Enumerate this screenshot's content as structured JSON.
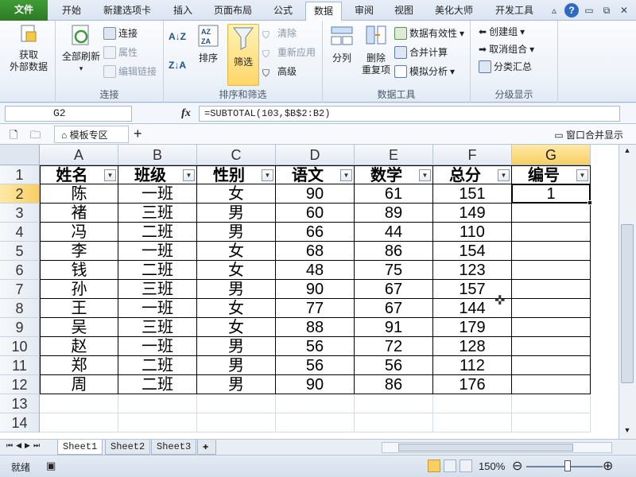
{
  "ribbon_tabs": {
    "file": "文件",
    "items": [
      "开始",
      "新建选项卡",
      "插入",
      "页面布局",
      "公式",
      "数据",
      "审阅",
      "视图",
      "美化大师",
      "开发工具"
    ]
  },
  "ribbon": {
    "get_external": "获取\n外部数据",
    "refresh_all": "全部刷新",
    "connections": "连接",
    "properties": "属性",
    "edit_links": "编辑链接",
    "group_connections": "连接",
    "sort": "排序",
    "filter": "筛选",
    "clear": "清除",
    "reapply": "重新应用",
    "advanced": "高级",
    "group_sort_filter": "排序和筛选",
    "text_to_columns": "分列",
    "remove_duplicates": "删除\n重复项",
    "data_validation": "数据有效性",
    "consolidate": "合并计算",
    "what_if": "模拟分析",
    "group_data_tools": "数据工具",
    "group": "创建组",
    "ungroup": "取消组合",
    "subtotal": "分类汇总",
    "group_outline": "分级显示"
  },
  "formula_bar": {
    "name_box": "G2",
    "fx": "fx",
    "formula": "=SUBTOTAL(103,$B$2:B2)"
  },
  "workbook_strip": {
    "template_zone": "模板专区",
    "window_merge": "窗口合并显示"
  },
  "columns": [
    "A",
    "B",
    "C",
    "D",
    "E",
    "F",
    "G"
  ],
  "rows": [
    "1",
    "2",
    "3",
    "4",
    "5",
    "6",
    "7",
    "8",
    "9",
    "10",
    "11",
    "12",
    "13",
    "14"
  ],
  "table": {
    "headers": [
      "姓名",
      "班级",
      "性别",
      "语文",
      "数学",
      "总分",
      "编号"
    ],
    "data": [
      [
        "陈",
        "一班",
        "女",
        "90",
        "61",
        "151",
        "1"
      ],
      [
        "褚",
        "三班",
        "男",
        "60",
        "89",
        "149",
        ""
      ],
      [
        "冯",
        "二班",
        "男",
        "66",
        "44",
        "110",
        ""
      ],
      [
        "李",
        "一班",
        "女",
        "68",
        "86",
        "154",
        ""
      ],
      [
        "钱",
        "二班",
        "女",
        "48",
        "75",
        "123",
        ""
      ],
      [
        "孙",
        "三班",
        "男",
        "90",
        "67",
        "157",
        ""
      ],
      [
        "王",
        "一班",
        "女",
        "77",
        "67",
        "144",
        ""
      ],
      [
        "吴",
        "三班",
        "女",
        "88",
        "91",
        "179",
        ""
      ],
      [
        "赵",
        "一班",
        "男",
        "56",
        "72",
        "128",
        ""
      ],
      [
        "郑",
        "二班",
        "男",
        "56",
        "56",
        "112",
        ""
      ],
      [
        "周",
        "二班",
        "男",
        "90",
        "86",
        "176",
        ""
      ]
    ]
  },
  "sheets": [
    "Sheet1",
    "Sheet2",
    "Sheet3"
  ],
  "status": {
    "ready": "就绪",
    "zoom": "150%"
  },
  "colors": {
    "file_tab": "#2c7a24",
    "selected_header": "#f9cf63",
    "ribbon_bg": "#eef3fa"
  }
}
